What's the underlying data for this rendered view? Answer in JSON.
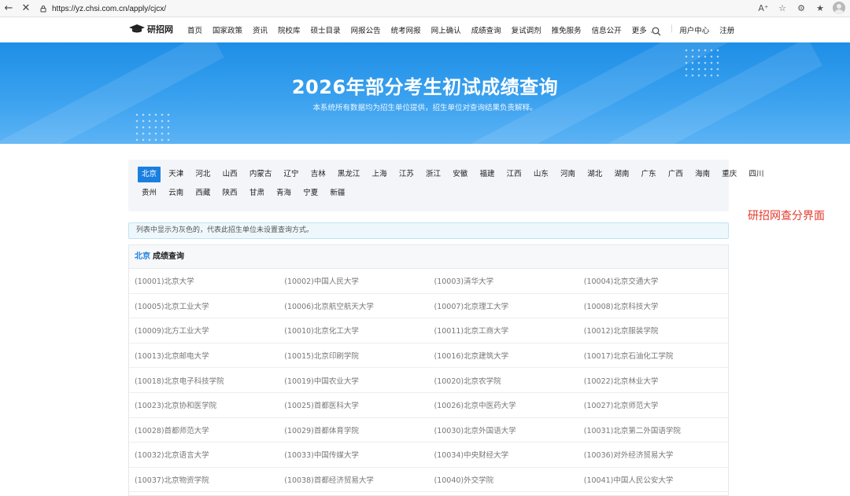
{
  "browser": {
    "url": "https://yz.chsi.com.cn/apply/cjcx/",
    "back_icon": "back-arrow-icon",
    "stop_icon": "close-icon"
  },
  "header": {
    "logo_text": "研招网",
    "nav": [
      "首页",
      "国家政策",
      "资讯",
      "院校库",
      "硕士目录",
      "网报公告",
      "统考网报",
      "网上确认",
      "成绩查询",
      "复试调剂",
      "推免服务",
      "信息公开",
      "更多"
    ],
    "user_center": "用户中心",
    "register": "注册"
  },
  "banner": {
    "title": "2026年部分考生初试成绩查询",
    "subtitle": "本系统所有数据均为招生单位提供，招生单位对查询结果负责解释。"
  },
  "provinces": {
    "row1": [
      "北京",
      "天津",
      "河北",
      "山西",
      "内蒙古",
      "辽宁",
      "吉林",
      "黑龙江",
      "上海",
      "江苏",
      "浙江",
      "安徽",
      "福建",
      "江西",
      "山东",
      "河南",
      "湖北",
      "湖南",
      "广东",
      "广西",
      "海南",
      "重庆",
      "四川"
    ],
    "row2": [
      "贵州",
      "云南",
      "西藏",
      "陕西",
      "甘肃",
      "青海",
      "宁夏",
      "新疆"
    ],
    "selected": "北京"
  },
  "side_note": "研招网查分界面",
  "notice": "列表中显示为灰色的，代表此招生单位未设置查询方式。",
  "results": {
    "province": "北京",
    "title": "成绩查询",
    "rows": [
      [
        "(10001)北京大学",
        "(10002)中国人民大学",
        "(10003)清华大学",
        "(10004)北京交通大学"
      ],
      [
        "(10005)北京工业大学",
        "(10006)北京航空航天大学",
        "(10007)北京理工大学",
        "(10008)北京科技大学"
      ],
      [
        "(10009)北方工业大学",
        "(10010)北京化工大学",
        "(10011)北京工商大学",
        "(10012)北京服装学院"
      ],
      [
        "(10013)北京邮电大学",
        "(10015)北京印刷学院",
        "(10016)北京建筑大学",
        "(10017)北京石油化工学院"
      ],
      [
        "(10018)北京电子科技学院",
        "(10019)中国农业大学",
        "(10020)北京农学院",
        "(10022)北京林业大学"
      ],
      [
        "(10023)北京协和医学院",
        "(10025)首都医科大学",
        "(10026)北京中医药大学",
        "(10027)北京师范大学"
      ],
      [
        "(10028)首都师范大学",
        "(10029)首都体育学院",
        "(10030)北京外国语大学",
        "(10031)北京第二外国语学院"
      ],
      [
        "(10032)北京语言大学",
        "(10033)中国传媒大学",
        "(10034)中央财经大学",
        "(10036)对外经济贸易大学"
      ],
      [
        "(10037)北京物资学院",
        "(10038)首都经济贸易大学",
        "(10040)外交学院",
        "(10041)中国人民公安大学"
      ]
    ]
  },
  "colors": {
    "accent": "#1a7fe0",
    "banner_top": "#1e8ee6",
    "banner_bottom": "#5cb3f4",
    "side_note": "#e43a2e"
  }
}
